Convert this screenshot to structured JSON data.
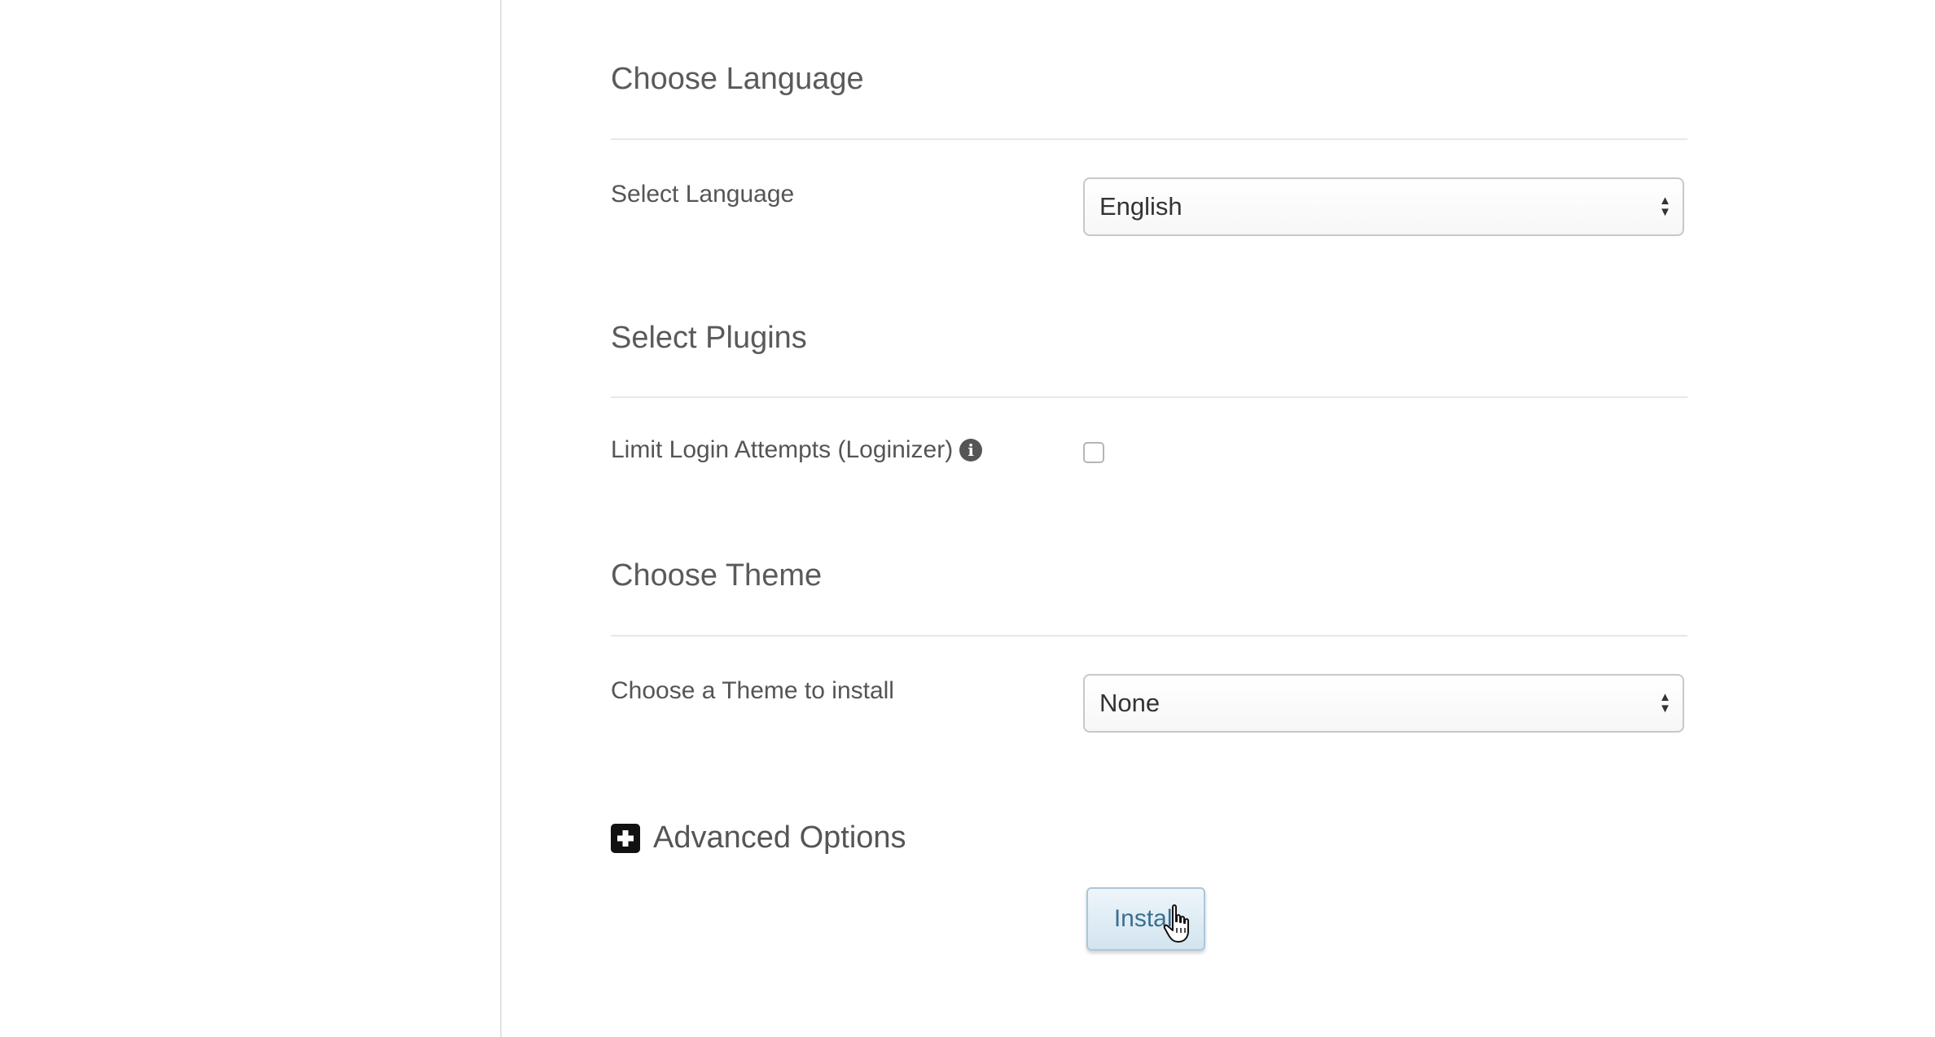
{
  "language_section": {
    "title": "Choose Language",
    "field_label": "Select Language",
    "selected_value": "English"
  },
  "plugins_section": {
    "title": "Select Plugins",
    "plugin_label": "Limit Login Attempts (Loginizer)",
    "plugin_checked": false,
    "info_icon": "info-icon"
  },
  "theme_section": {
    "title": "Choose Theme",
    "field_label": "Choose a Theme to install",
    "selected_value": "None"
  },
  "advanced": {
    "label": "Advanced Options",
    "icon": "plus-square-icon"
  },
  "install_button": {
    "label": "Install"
  },
  "colors": {
    "button_text": "#3a6f92",
    "button_border": "#a9c7dc"
  }
}
